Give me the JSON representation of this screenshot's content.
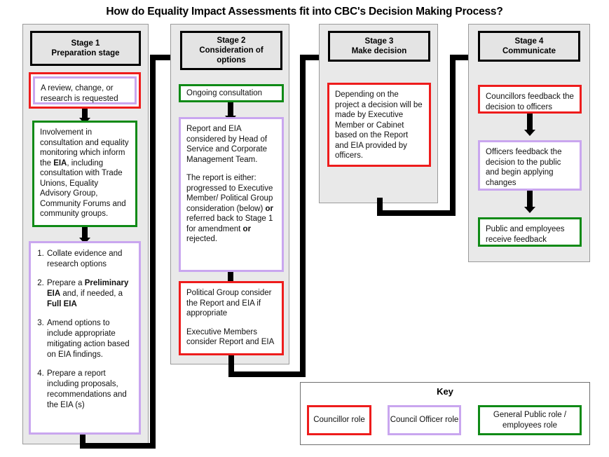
{
  "title": "How do Equality Impact Assessments fit into CBC's Decision Making Process?",
  "colors": {
    "councillor_red": "#ee1c1c",
    "council_officer_purple": "#c9a6ef",
    "public_green": "#0f8a16",
    "panel_fill": "#e9e9e9",
    "connector_black": "#000000"
  },
  "stages": [
    {
      "id": "stage1",
      "header_line1": "Stage 1",
      "header_line2": "Preparation stage",
      "boxes": [
        {
          "id": "s1-b1",
          "role": "councillor-and-officer",
          "outer_color": "red",
          "inner_color": "purple",
          "text": "A review, change, or research is requested"
        },
        {
          "id": "s1-b2",
          "role": "general-public",
          "outer_color": "green",
          "text": "Involvement in consultation and equality monitoring which inform the ",
          "bold_1": "EIA",
          "text_2": ", including consultation with Trade Unions, Equality Advisory Group, Community Forums and community groups."
        },
        {
          "id": "s1-b3",
          "role": "council-officer",
          "outer_color": "purple",
          "items": [
            {
              "text_1": "Collate evidence and research options"
            },
            {
              "text_1": "Prepare a ",
              "bold_1": "Preliminary EIA",
              "text_2": " and, if needed, a ",
              "bold_2": "Full EIA"
            },
            {
              "text_1": "Amend options to include appropriate mitigating action based on EIA findings."
            },
            {
              "text_1": "Prepare a report including proposals, recommendations and the EIA (s)"
            }
          ]
        }
      ]
    },
    {
      "id": "stage2",
      "header_line1": "Stage 2",
      "header_line2": "Consideration of",
      "header_line3": "options",
      "boxes": [
        {
          "id": "s2-b1",
          "role": "general-public",
          "outer_color": "green",
          "text": "Ongoing consultation"
        },
        {
          "id": "s2-b2",
          "role": "council-officer",
          "outer_color": "purple",
          "para_1": "Report and EIA considered by Head of Service and Corporate Management Team.",
          "para_2_a": "The report is either: progressed to Executive Member/ Political Group consideration (below) ",
          "para_2_bold_1": "or",
          "para_2_b": " referred back to Stage 1 for amendment ",
          "para_2_bold_2": "or",
          "para_2_c": " rejected."
        },
        {
          "id": "s2-b3",
          "role": "councillor",
          "outer_color": "red",
          "para_1": "Political Group consider the Report and EIA if appropriate",
          "para_2": "Executive Members consider Report and EIA"
        }
      ]
    },
    {
      "id": "stage3",
      "header_line1": "Stage 3",
      "header_line2": "Make decision",
      "boxes": [
        {
          "id": "s3-b1",
          "role": "councillor",
          "outer_color": "red",
          "text": "Depending on the project a decision will be made by Executive Member or Cabinet based on the Report and EIA provided by officers."
        }
      ]
    },
    {
      "id": "stage4",
      "header_line1": "Stage 4",
      "header_line2": "Communicate",
      "boxes": [
        {
          "id": "s4-b1",
          "role": "councillor",
          "outer_color": "red",
          "text": "Councillors feedback the decision to officers"
        },
        {
          "id": "s4-b2",
          "role": "council-officer",
          "outer_color": "purple",
          "text": "Officers feedback the decision to the public and begin applying changes"
        },
        {
          "id": "s4-b3",
          "role": "general-public",
          "outer_color": "green",
          "text": "Public and employees receive feedback"
        }
      ]
    }
  ],
  "key": {
    "title": "Key",
    "items": [
      {
        "label": "Councillor role",
        "color": "red"
      },
      {
        "label": "Council Officer role",
        "color": "purple"
      },
      {
        "label": "General Public role / employees role",
        "color": "green"
      }
    ]
  }
}
